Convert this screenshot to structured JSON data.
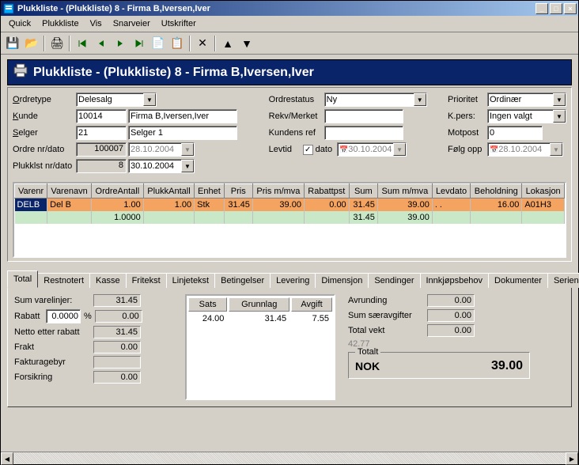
{
  "window": {
    "title": "Plukkliste -  (Plukkliste) 8 - Firma B,Iversen,Iver"
  },
  "menu": [
    "Quick",
    "Plukkliste",
    "Vis",
    "Snarveier",
    "Utskrifter"
  ],
  "header": {
    "title": "Plukkliste -  (Plukkliste) 8 - Firma B,Iversen,Iver"
  },
  "form": {
    "ordretype_lbl": "Ordretype",
    "ordretype_val": "Delesalg",
    "kunde_lbl": "Kunde",
    "kunde_val": "10014",
    "kunde_navn": "Firma B,Iversen,Iver",
    "selger_lbl": "Selger",
    "selger_val": "21",
    "selger_navn": "Selger 1",
    "ordrenr_lbl": "Ordre nr/dato",
    "ordrenr_val": "100007",
    "ordredato_val": "28.10.2004",
    "plukk_lbl": "Plukklst nr/dato",
    "plukk_val": "8",
    "plukkdato_val": "30.10.2004",
    "ordrestatus_lbl": "Ordrestatus",
    "ordrestatus_val": "Ny",
    "rekv_lbl": "Rekv/Merket",
    "rekv_val": "",
    "kundens_lbl": "Kundens ref",
    "kundens_val": "",
    "levtid_lbl": "Levtid",
    "levtid_chk": "dato",
    "levtid_val": "30.10.2004",
    "prioritet_lbl": "Prioritet",
    "prioritet_val": "Ordinær",
    "kpers_lbl": "K.pers:",
    "kpers_val": "Ingen valgt",
    "motpost_lbl": "Motpost",
    "motpost_val": "0",
    "folg_lbl": "Følg opp",
    "folg_val": "28.10.2004"
  },
  "grid": {
    "headers": [
      "Varenr",
      "Varenavn",
      "OrdreAntall",
      "PlukkAntall",
      "Enhet",
      "Pris",
      "Pris m/mva",
      "Rabattpst",
      "Sum",
      "Sum m/mva",
      "Levdato",
      "Beholdning",
      "Lokasjon"
    ],
    "row": {
      "varenr": "DELB",
      "varenavn": "Del B",
      "ordreantall": "1.00",
      "plukkantall": "1.00",
      "enhet": "Stk",
      "pris": "31.45",
      "prismva": "39.00",
      "rabattpst": "0.00",
      "sum": "31.45",
      "summva": "39.00",
      "levdato": ". .",
      "beholdning": "16.00",
      "lokasjon": "A01H3"
    },
    "sumrow": {
      "ordreantall": "1.0000",
      "sum": "31.45",
      "summva": "39.00"
    }
  },
  "tabs": [
    "Total",
    "Restnotert",
    "Kasse",
    "Fritekst",
    "Linjetekst",
    "Betingelser",
    "Levering",
    "Dimensjon",
    "Sendinger",
    "Innkjøpsbehov",
    "Dokumenter",
    "Serienr"
  ],
  "totals": {
    "sumvarelinjer_lbl": "Sum varelinjer:",
    "sumvarelinjer": "31.45",
    "rabatt_lbl": "Rabatt",
    "rabatt_pct": "0.0000",
    "pct": "%",
    "rabatt": "0.00",
    "netto_lbl": "Netto etter rabatt",
    "netto": "31.45",
    "frakt_lbl": "Frakt",
    "frakt": "0.00",
    "fakturagebyr_lbl": "Fakturagebyr",
    "fakturagebyr": "",
    "forsikring_lbl": "Forsikring",
    "forsikring": "0.00",
    "avrunding_lbl": "Avrunding",
    "avrunding": "0.00",
    "saeravgifter_lbl": "Sum særavgifter",
    "saeravgifter": "0.00",
    "totalvekt_lbl": "Total vekt",
    "totalvekt": "0.00",
    "totalvekt_gray": "42.77",
    "totalt_lbl": "Totalt",
    "currency": "NOK",
    "totalt": "39.00",
    "vat": {
      "headers": [
        "Sats",
        "Grunnlag",
        "Avgift"
      ],
      "row": [
        "24.00",
        "31.45",
        "7.55"
      ]
    }
  }
}
